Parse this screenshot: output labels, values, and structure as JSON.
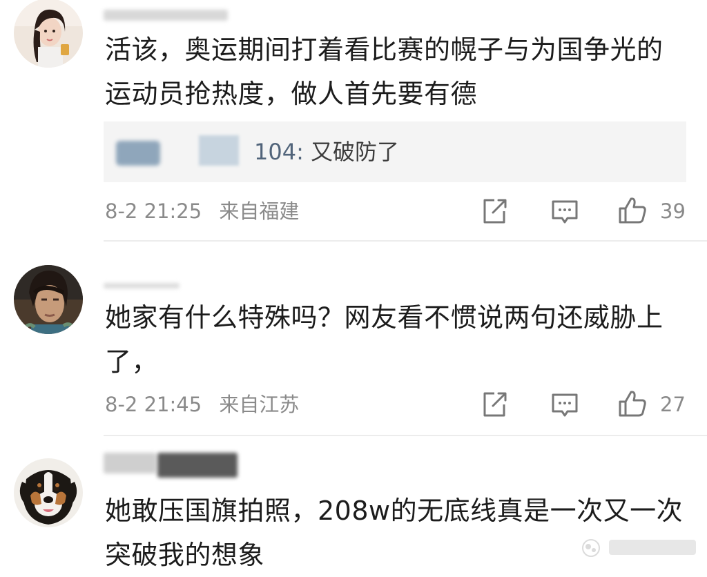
{
  "comments": [
    {
      "text_line1": "活该，奥运期间打着看比赛的幌子与为国争光的",
      "text_line2": "运动员抢热度，做人首先要有德",
      "reply": {
        "user_suffix": "104:",
        "text": "又破防了"
      },
      "time": "8-2 21:25",
      "location": "来自福建",
      "likes": "39"
    },
    {
      "text_line1": "她家有什么特殊吗？网友看不惯说两句还威胁上",
      "text_line2": "了，",
      "time": "8-2 21:45",
      "location": "来自江苏",
      "likes": "27"
    },
    {
      "text_line1": "她敢压国旗拍照，208w的无底线真是一次又一次",
      "text_line2": "突破我的想象"
    }
  ],
  "icons": {
    "share": "share-icon",
    "comment": "comment-icon",
    "like": "thumbs-up-icon"
  },
  "colors": {
    "meta_text": "#8a8a8a",
    "body_text": "#1c1c1c",
    "reply_bg": "#f4f4f4",
    "reply_user": "#51647a",
    "divider": "#ececec"
  }
}
